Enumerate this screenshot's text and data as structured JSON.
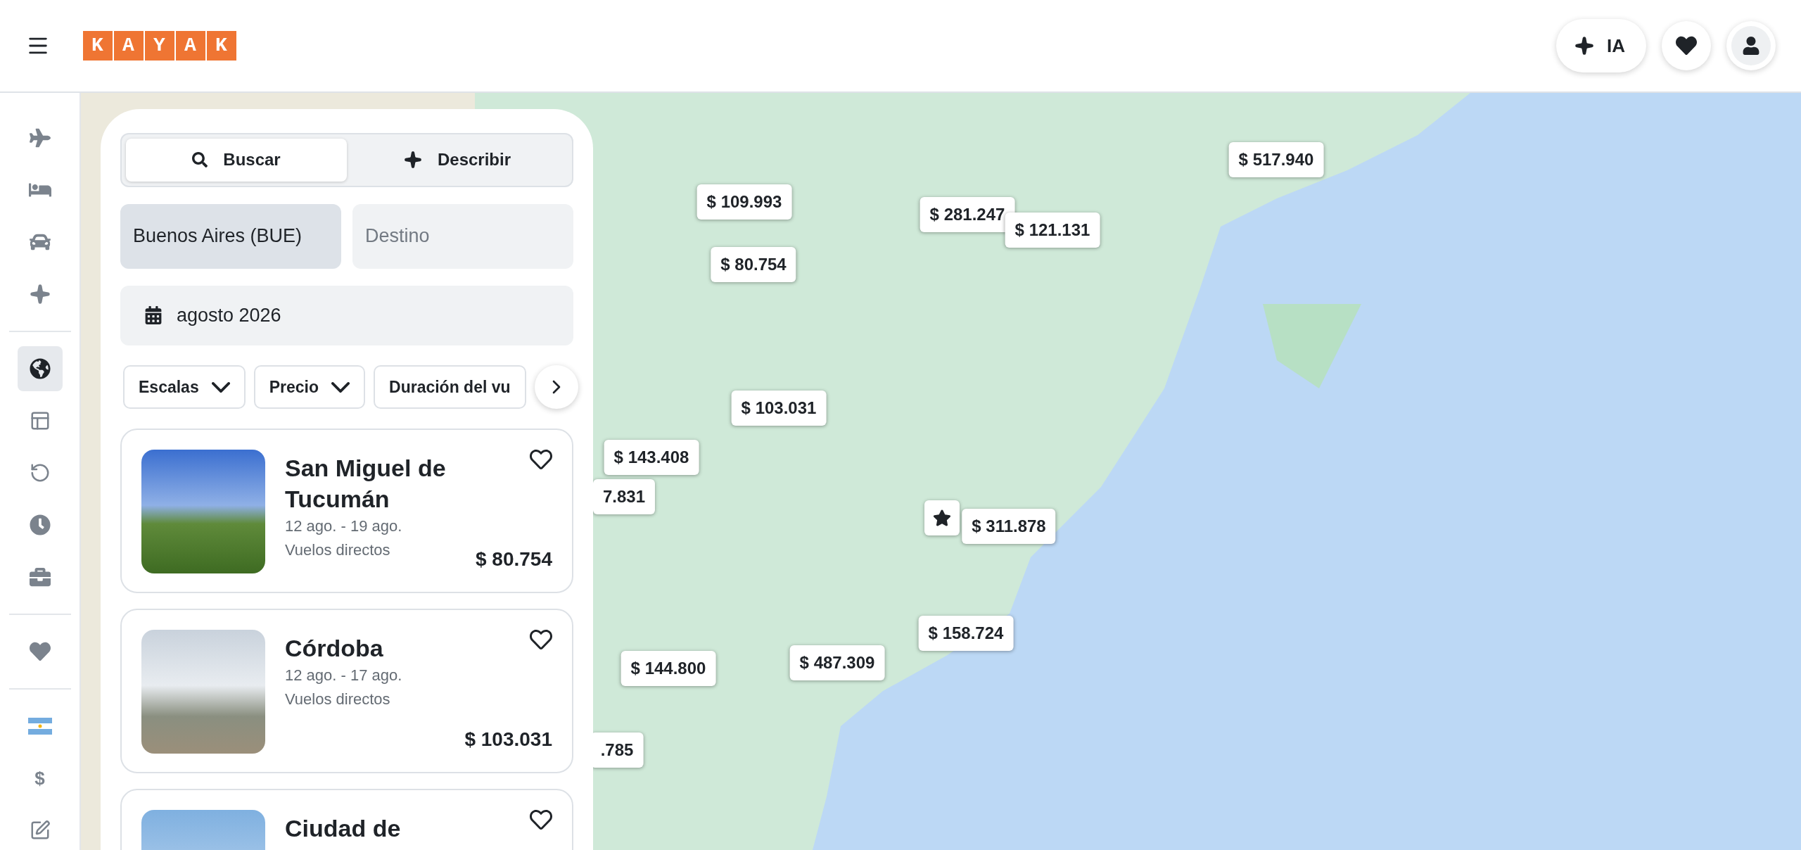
{
  "header": {
    "logo": "KAYAK",
    "ai_button": {
      "label": "IA"
    }
  },
  "sidebar": {
    "groups": [
      [
        {
          "kind": "icon",
          "selected": false
        },
        {
          "kind": "icon",
          "selected": false
        },
        {
          "kind": "icon",
          "selected": false
        },
        {
          "kind": "icon",
          "selected": false
        }
      ],
      [
        {
          "kind": "icon",
          "selected": true
        },
        {
          "kind": "icon",
          "selected": false
        },
        {
          "kind": "icon",
          "selected": false
        },
        {
          "kind": "icon",
          "selected": false
        },
        {
          "kind": "icon",
          "selected": false
        }
      ],
      [
        {
          "kind": "icon",
          "selected": false
        }
      ],
      [
        {
          "kind": "icon",
          "selected": false
        },
        {
          "kind": "text",
          "label": "$",
          "selected": false
        },
        {
          "kind": "icon",
          "selected": false
        }
      ]
    ]
  },
  "search_panel": {
    "mode_tabs": [
      {
        "label": "Buscar",
        "selected": true
      },
      {
        "label": "Describir",
        "selected": false
      }
    ],
    "origin": {
      "value": "Buenos Aires (BUE)"
    },
    "destination": {
      "placeholder": "Destino"
    },
    "dates": {
      "value": "agosto 2026"
    },
    "filters": [
      {
        "label": "Escalas"
      },
      {
        "label": "Precio"
      },
      {
        "label": "Duración del vu"
      }
    ]
  },
  "results": [
    {
      "title": "San Miguel de Tucumán",
      "dates": "12 ago. - 19 ago.",
      "flights": "Vuelos directos",
      "price": "$ 80.754",
      "favorite": false
    },
    {
      "title": "Córdoba",
      "dates": "12 ago. - 17 ago.",
      "flights": "Vuelos directos",
      "price": "$ 103.031",
      "favorite": false
    },
    {
      "title": "Ciudad de",
      "favorite": false
    }
  ],
  "map": {
    "pins": [
      {
        "kind": "price",
        "label": "$ 109.993"
      },
      {
        "kind": "price",
        "label": "$ 281.247"
      },
      {
        "kind": "price",
        "label": "$ 121.131"
      },
      {
        "kind": "price",
        "label": "$ 517.940"
      },
      {
        "kind": "price",
        "label": "$ 80.754"
      },
      {
        "kind": "price",
        "label": "$ 103.031"
      },
      {
        "kind": "price",
        "label": "$ 143.408"
      },
      {
        "kind": "price",
        "label": "7.831"
      },
      {
        "kind": "origin"
      },
      {
        "kind": "price",
        "label": "$ 311.878"
      },
      {
        "kind": "price",
        "label": "$ 158.724"
      },
      {
        "kind": "price",
        "label": "$ 487.309"
      },
      {
        "kind": "price",
        "label": "$ 144.800"
      },
      {
        "kind": "price",
        "label": ".785"
      }
    ]
  }
}
